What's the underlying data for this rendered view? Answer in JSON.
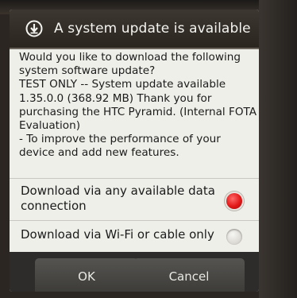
{
  "dialog": {
    "title": "A system update is available",
    "icon": "download-icon",
    "message": {
      "question": "Would you like to download the following system software update?",
      "details": "TEST ONLY -- System update available 1.35.0.0 (368.92 MB)  Thank you for purchasing the HTC Pyramid. (Internal FOTA Evaluation)",
      "features": "- To improve the performance of your device and add new features."
    },
    "options": [
      {
        "label": "Download via any available data connection",
        "selected": true
      },
      {
        "label": "Download via Wi-Fi or cable only",
        "selected": false
      }
    ],
    "buttons": {
      "ok": "OK",
      "cancel": "Cancel"
    }
  },
  "colors": {
    "title_bar": "#2b2520",
    "dialog_body": "#efefea",
    "radio_selected": "#e21818",
    "button_bar": "#2d2c2a"
  }
}
